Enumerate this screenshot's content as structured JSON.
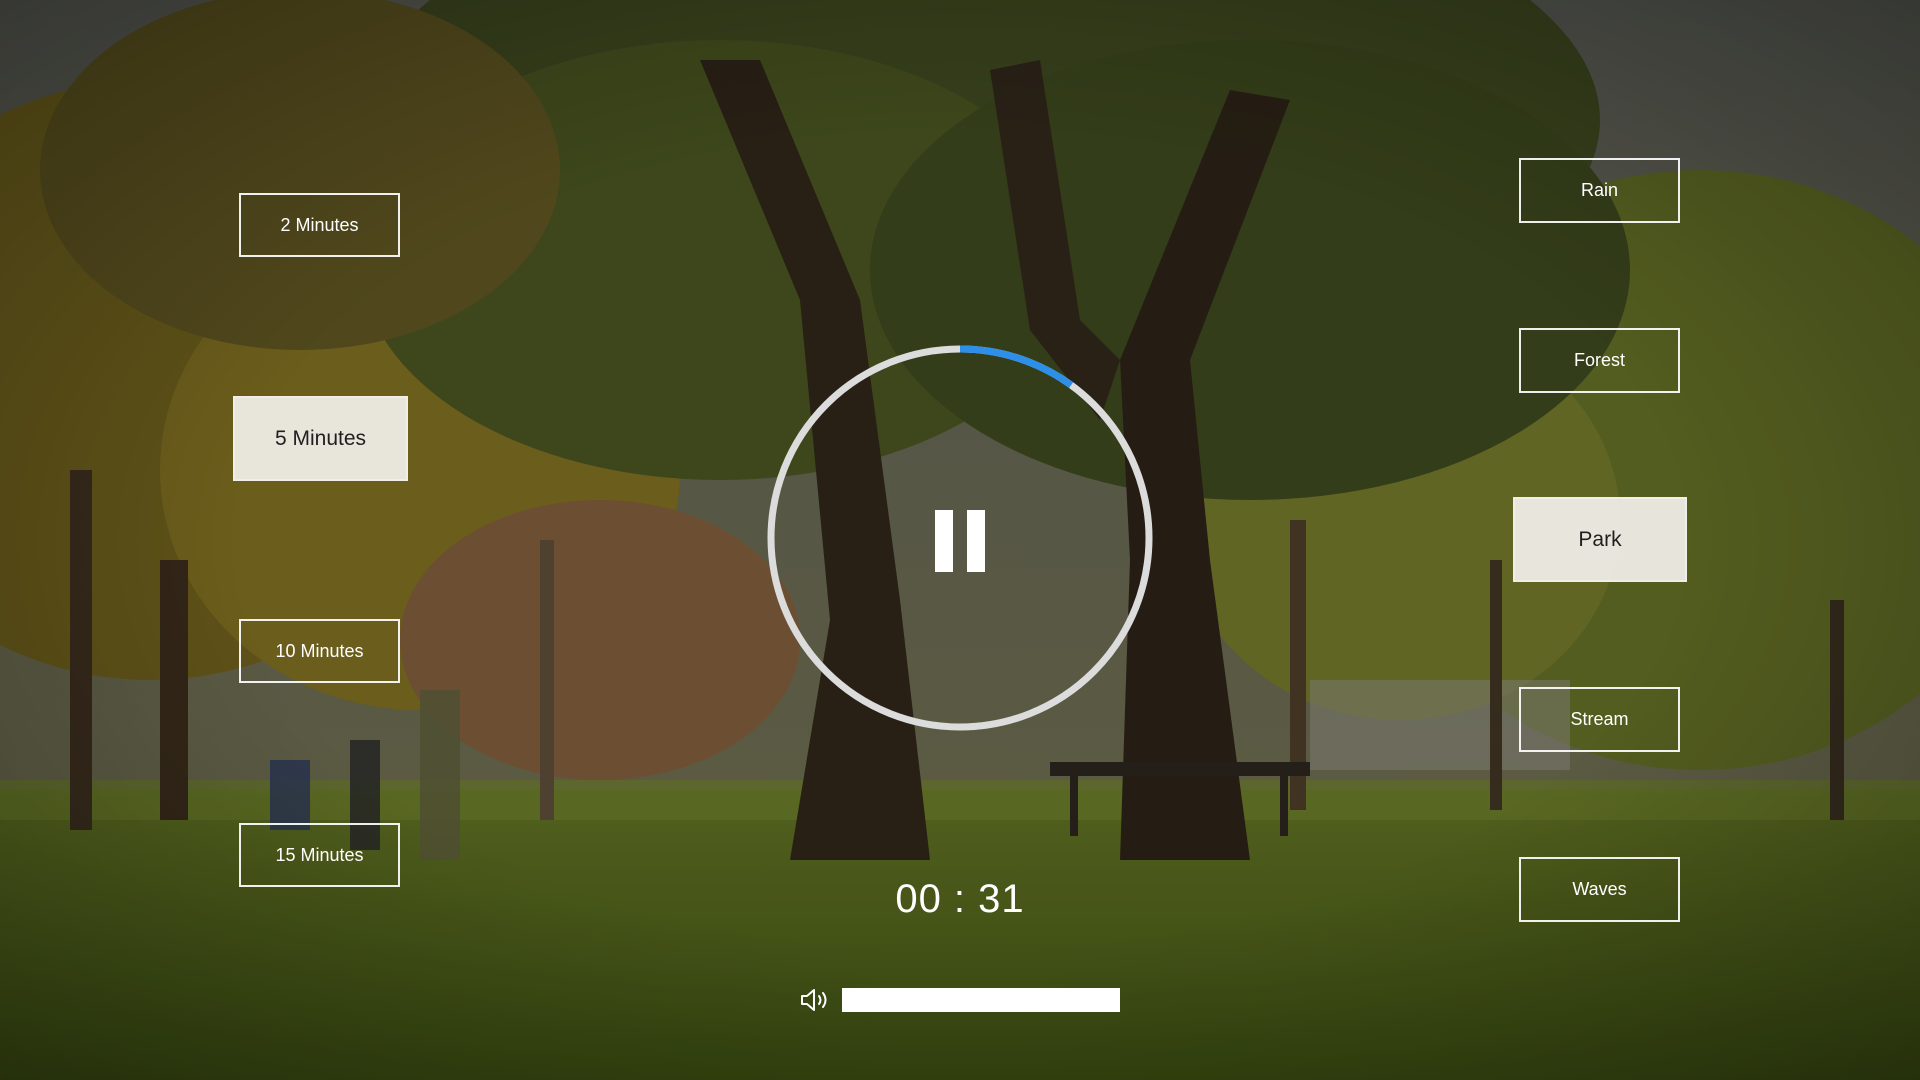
{
  "durations": [
    {
      "id": "btn-2m",
      "label": "2 Minutes",
      "active": false
    },
    {
      "id": "btn-5m",
      "label": "5 Minutes",
      "active": true
    },
    {
      "id": "btn-10m",
      "label": "10 Minutes",
      "active": false
    },
    {
      "id": "btn-15m",
      "label": "15 Minutes",
      "active": false
    }
  ],
  "sounds": [
    {
      "id": "btn-rain",
      "label": "Rain",
      "active": false
    },
    {
      "id": "btn-forest",
      "label": "Forest",
      "active": false
    },
    {
      "id": "btn-park",
      "label": "Park",
      "active": true
    },
    {
      "id": "btn-stream",
      "label": "Stream",
      "active": false
    },
    {
      "id": "btn-waves",
      "label": "Waves",
      "active": false
    }
  ],
  "player": {
    "state": "playing",
    "control_icon": "pause-icon",
    "timer": "00 : 31",
    "progress_fraction": 0.1,
    "volume_fraction": 1.0
  },
  "colors": {
    "ring_track": "#dcdcdc",
    "ring_progress": "#2e8fe8",
    "button_active_bg": "#f0eee8"
  }
}
